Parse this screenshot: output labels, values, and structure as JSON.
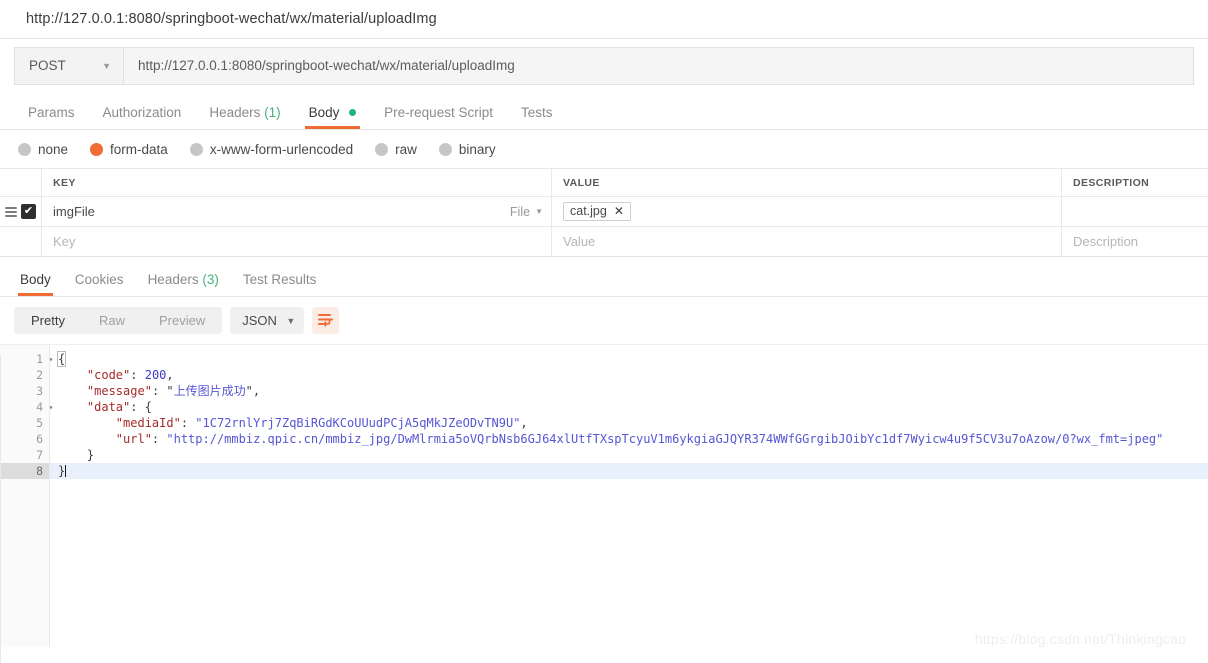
{
  "window": {
    "url_title": "http://127.0.0.1:8080/springboot-wechat/wx/material/uploadImg"
  },
  "request": {
    "method": "POST",
    "method_caret": "▼",
    "url": "http://127.0.0.1:8080/springboot-wechat/wx/material/uploadImg",
    "tabs": [
      {
        "label": "Params",
        "count": "",
        "dot": false,
        "active": false
      },
      {
        "label": "Authorization",
        "count": "",
        "dot": false,
        "active": false
      },
      {
        "label": "Headers",
        "count": "(1)",
        "dot": false,
        "active": false
      },
      {
        "label": "Body",
        "count": "",
        "dot": true,
        "active": true
      },
      {
        "label": "Pre-request Script",
        "count": "",
        "dot": false,
        "active": false
      },
      {
        "label": "Tests",
        "count": "",
        "dot": false,
        "active": false
      }
    ],
    "body_types": [
      {
        "label": "none",
        "selected": false
      },
      {
        "label": "form-data",
        "selected": true
      },
      {
        "label": "x-www-form-urlencoded",
        "selected": false
      },
      {
        "label": "raw",
        "selected": false
      },
      {
        "label": "binary",
        "selected": false
      }
    ],
    "table": {
      "columns": [
        "KEY",
        "VALUE",
        "DESCRIPTION"
      ],
      "rows": [
        {
          "checked": true,
          "key": "imgFile",
          "type_label": "File",
          "type_caret": "▼",
          "file_name": "cat.jpg",
          "file_remove": "✕",
          "description": ""
        }
      ],
      "placeholders": {
        "key": "Key",
        "value": "Value",
        "description": "Description"
      }
    }
  },
  "response": {
    "tabs": [
      {
        "label": "Body",
        "count": "",
        "active": true
      },
      {
        "label": "Cookies",
        "count": "",
        "active": false
      },
      {
        "label": "Headers",
        "count": "(3)",
        "active": false
      },
      {
        "label": "Test Results",
        "count": "",
        "active": false
      }
    ],
    "view_modes": [
      {
        "label": "Pretty",
        "active": true
      },
      {
        "label": "Raw",
        "active": false
      },
      {
        "label": "Preview",
        "active": false
      }
    ],
    "format": "JSON",
    "format_caret": "▼",
    "wrap_icon": "word-wrap-icon",
    "body": {
      "code": 200,
      "message": "上传图片成功",
      "data": {
        "mediaId": "1C72rnlYrj7ZqBiRGdKCoUUudPCjA5qMkJZeODvTN9U",
        "url": "http://mmbiz.qpic.cn/mmbiz_jpg/DwMlrmia5oVQrbNsb6GJ64xlUtfTXspTcyuV1m6ykgiaGJQYR374WWfGGrgibJOibYc1df7Wyicw4u9f5CV3u7oAzow/0?wx_fmt=jpeg"
      }
    },
    "lines": [
      {
        "no": "1",
        "fold": "▾",
        "current": false
      },
      {
        "no": "2",
        "fold": "",
        "current": false
      },
      {
        "no": "3",
        "fold": "",
        "current": false
      },
      {
        "no": "4",
        "fold": "▾",
        "current": false
      },
      {
        "no": "5",
        "fold": "",
        "current": false
      },
      {
        "no": "6",
        "fold": "",
        "current": false
      },
      {
        "no": "7",
        "fold": "",
        "current": false
      },
      {
        "no": "8",
        "fold": "",
        "current": true
      }
    ],
    "code_lines": [
      "{",
      "    \"code\": 200,",
      "    \"message\": \"上传图片成功\",",
      "    \"data\": {",
      "        \"mediaId\": \"1C72rnlYrj7ZqBiRGdKCoUUudPCjA5qMkJZeODvTN9U\",",
      "        \"url\": \"http://mmbiz.qpic.cn/mmbiz_jpg/DwMlrmia5oVQrbNsb6GJ64xlUtfTXspTcyuV1m6ykgiaGJQYR374WWfGGrgibJOibYc1df7Wyicw4u9f5CV3u7oAzow/0?wx_fmt=jpeg\"",
      "    }",
      "}"
    ]
  },
  "watermark": "https://blog.csdn.net/Thinkingcao",
  "colors": {
    "accent": "#f06c35",
    "tab_indicator": "#f06c35",
    "body_dot": "#20b677",
    "count_green": "#4caf7d",
    "json_key": "#a52a2a",
    "json_string": "#5656d6",
    "json_number": "#3b3bc9",
    "current_line": "#e8f1fb"
  }
}
